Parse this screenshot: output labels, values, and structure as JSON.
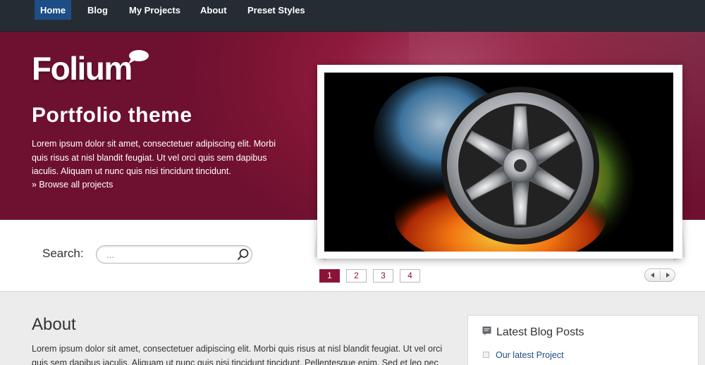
{
  "nav": {
    "items": [
      {
        "label": "Home",
        "active": true
      },
      {
        "label": "Blog",
        "active": false
      },
      {
        "label": "My Projects",
        "active": false
      },
      {
        "label": "About",
        "active": false
      },
      {
        "label": "Preset Styles",
        "active": false
      }
    ]
  },
  "hero": {
    "logo": "Folium",
    "title": "Portfolio theme",
    "text": "Lorem ipsum dolor sit amet, consectetuer adipiscing elit. Morbi quis risus at nisl blandit feugiat. Ut vel orci quis sem dapibus iaculis. Aliquam ut nunc quis nisi tincidunt tincidunt.",
    "browse_link": "» Browse all projects"
  },
  "search": {
    "label": "Search:",
    "placeholder": "..."
  },
  "slider": {
    "pages": [
      "1",
      "2",
      "3",
      "4"
    ],
    "active_page": "1"
  },
  "about": {
    "title": "About",
    "text": "Lorem ipsum dolor sit amet, consectetuer adipiscing elit. Morbi quis risus at nisl blandit feugiat. Ut vel orci quis sem dapibus iaculis. Aliquam ut nunc quis nisi tincidunt tincidunt. Pellentesque enim. Sed et leo nec"
  },
  "sidebar": {
    "title": "Latest Blog Posts",
    "posts": [
      "Our latest Project"
    ]
  },
  "colors": {
    "nav_bg": "#262c33",
    "nav_active": "#1d4e86",
    "hero_bg": "#8e1a3d",
    "accent": "#8a1438",
    "link": "#1d4e86"
  }
}
